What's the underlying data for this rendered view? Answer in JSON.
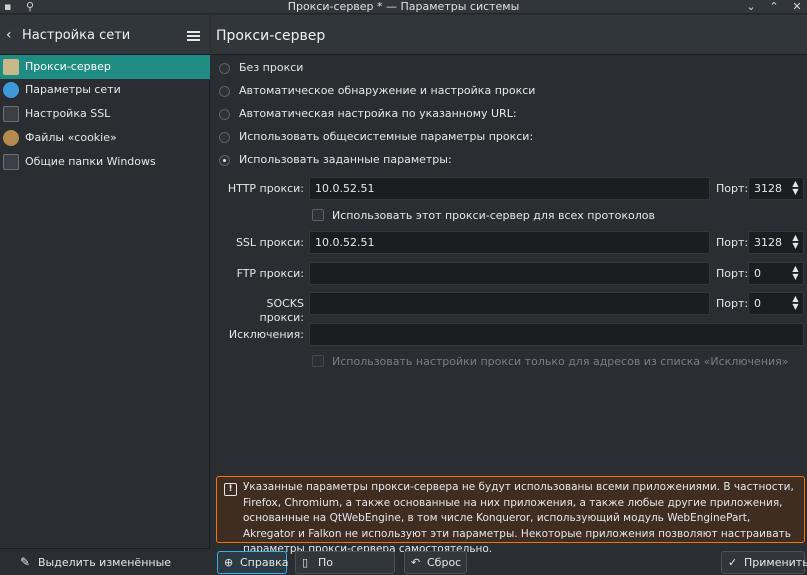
{
  "window": {
    "title": "Прокси-сервер * — Параметры системы",
    "icons": {
      "app": "kde-app-icon",
      "pin": "pin-icon",
      "minimize": "chevron-down-icon",
      "maximize": "chevron-up-icon",
      "close": "close-icon"
    }
  },
  "sidebar": {
    "title": "Настройка сети",
    "items": [
      {
        "label": "Прокси-сервер",
        "icon": "proxy-icon",
        "active": true
      },
      {
        "label": "Параметры сети",
        "icon": "globe-icon",
        "active": false
      },
      {
        "label": "Настройка SSL",
        "icon": "ssl-icon",
        "active": false
      },
      {
        "label": "Файлы «cookie»",
        "icon": "cookie-icon",
        "active": false
      },
      {
        "label": "Общие папки Windows",
        "icon": "windows-share-icon",
        "active": false
      }
    ],
    "footer_label": "Выделить изменённые пункты"
  },
  "main": {
    "title": "Прокси-сервер",
    "options": [
      {
        "label": "Без прокси",
        "selected": false
      },
      {
        "label": "Автоматическое обнаружение и настройка прокси",
        "selected": false
      },
      {
        "label": "Автоматическая настройка по указанному URL:",
        "selected": false
      },
      {
        "label": "Использовать общесистемные параметры прокси:",
        "selected": false
      },
      {
        "label": "Использовать заданные параметры:",
        "selected": true
      }
    ],
    "fields": {
      "http": {
        "label": "HTTP прокси:",
        "value": "10.0.52.51",
        "port_label": "Порт:",
        "port": "3128"
      },
      "use_all": "Использовать этот прокси-сервер для всех протоколов",
      "ssl": {
        "label": "SSL прокси:",
        "value": "10.0.52.51",
        "port_label": "Порт:",
        "port": "3128"
      },
      "ftp": {
        "label": "FTP прокси:",
        "value": "",
        "port_label": "Порт:",
        "port": "0"
      },
      "socks": {
        "label": "SOCKS прокси:",
        "value": "",
        "port_label": "Порт:",
        "port": "0"
      },
      "exceptions": {
        "label": "Исключения:",
        "value": ""
      },
      "exceptions_only": "Использовать настройки прокси только для адресов из списка «Исключения»"
    },
    "warning": "Указанные параметры прокси-сервера не будут использованы всеми приложениями. В частности, Firefox, Chromium, а также основанные на них приложения, а также любые другие приложения, основанные на QtWebEngine, в том числе Konqueror, использующий модуль WebEnginePart, Akregator и Falkon не используют эти параметры. Некоторые приложения позволяют настраивать параметры прокси-сервера самостоятельно."
  },
  "buttons": {
    "help": "Справка",
    "defaults": "По умолчанию",
    "reset": "Сброс",
    "apply": "Применить"
  },
  "colors": {
    "accent": "#3daee9",
    "selection": "#1f8d83",
    "warning_border": "#f67400",
    "background": "#2a2e32"
  }
}
